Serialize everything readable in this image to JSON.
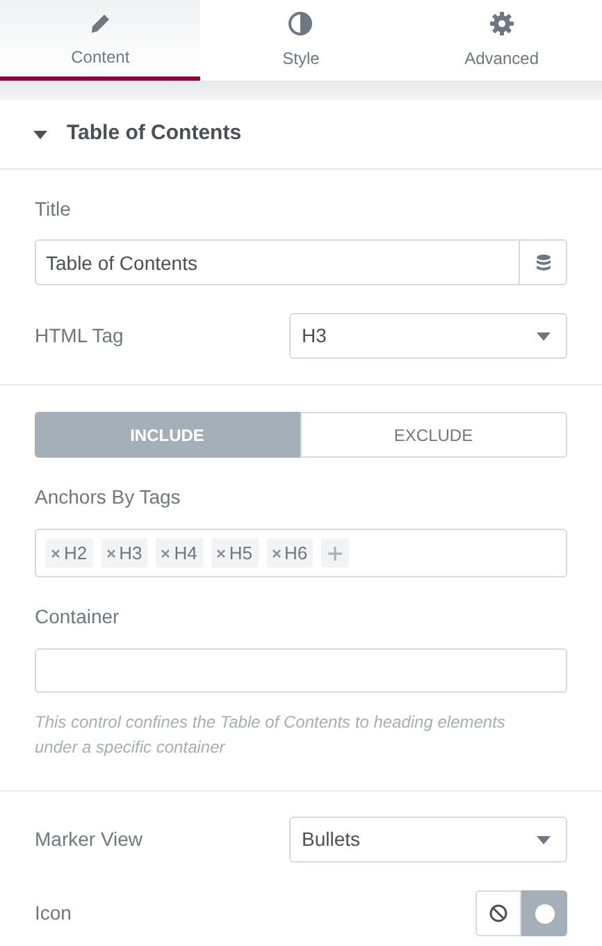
{
  "tabs": [
    {
      "label": "Content",
      "selected": true
    },
    {
      "label": "Style",
      "selected": false
    },
    {
      "label": "Advanced",
      "selected": false
    }
  ],
  "section": {
    "title": "Table of Contents",
    "expanded": true
  },
  "title_field": {
    "label": "Title",
    "value": "Table of Contents"
  },
  "html_tag": {
    "label": "HTML Tag",
    "value": "H3"
  },
  "filter": [
    {
      "label": "INCLUDE",
      "selected": true
    },
    {
      "label": "EXCLUDE",
      "selected": false
    }
  ],
  "anchors": {
    "label": "Anchors By Tags",
    "tags": [
      "H2",
      "H3",
      "H4",
      "H5",
      "H6"
    ]
  },
  "container": {
    "label": "Container",
    "description": "This control confines the Table of Contents to heading elements under a specific container"
  },
  "marker_view": {
    "label": "Marker View",
    "value": "Bullets"
  },
  "icon": {
    "label": "Icon",
    "options": [
      {
        "selected": false
      },
      {
        "selected": true
      }
    ]
  }
}
